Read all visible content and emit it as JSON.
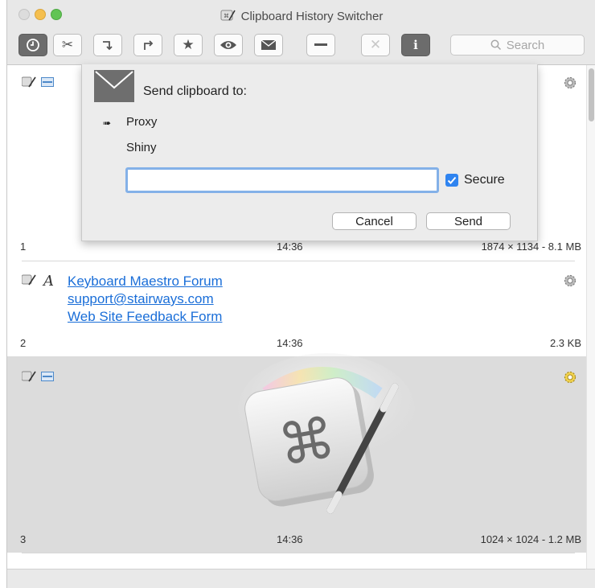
{
  "window": {
    "title": "Clipboard History Switcher"
  },
  "toolbar": {
    "buttons": [
      {
        "name": "history-button",
        "glyph": "clock-icon"
      },
      {
        "name": "cut-button",
        "glyph": "scissors-icon"
      },
      {
        "name": "insert-button",
        "glyph": "arrow-down-right-icon"
      },
      {
        "name": "redo-button",
        "glyph": "arrow-up-right-icon"
      },
      {
        "name": "favorite-button",
        "glyph": "star-icon"
      },
      {
        "name": "preview-button",
        "glyph": "eye-icon"
      },
      {
        "name": "send-button",
        "glyph": "envelope-icon"
      },
      {
        "name": "minimize-button",
        "glyph": "minus-icon"
      },
      {
        "name": "delete-button",
        "glyph": "x-icon"
      },
      {
        "name": "info-button",
        "glyph": "info-icon"
      }
    ],
    "search_placeholder": "Search"
  },
  "popover": {
    "title": "Send clipboard to:",
    "options": [
      "Proxy",
      "Shiny"
    ],
    "selected_option": "Proxy",
    "input_value": "",
    "secure_label": "Secure",
    "secure_checked": true,
    "cancel_label": "Cancel",
    "send_label": "Send"
  },
  "items": [
    {
      "number": "1",
      "time": "14:36",
      "meta": "1874 × 1134 - 8.1 MB",
      "type": "image"
    },
    {
      "number": "2",
      "time": "14:36",
      "meta": "2.3 KB",
      "type": "text",
      "links": [
        "Keyboard Maestro Forum",
        "support@stairways.com",
        "Web Site Feedback Form"
      ]
    },
    {
      "number": "3",
      "time": "14:36",
      "meta": "1024 × 1024 - 1.2 MB",
      "type": "image",
      "selected": true
    }
  ],
  "colors": {
    "accent": "#2f84f0",
    "link": "#1a6ed8",
    "selection": "#dcdcdc",
    "button_active": "#6c6c6c"
  }
}
